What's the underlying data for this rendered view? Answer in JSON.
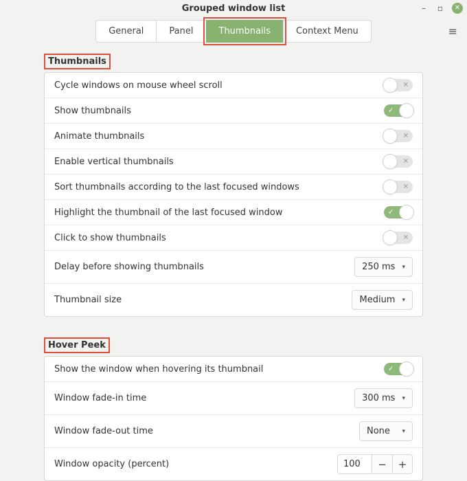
{
  "window": {
    "title": "Grouped window list"
  },
  "tabs": {
    "general": "General",
    "panel": "Panel",
    "thumbnails": "Thumbnails",
    "context_menu": "Context Menu",
    "active": "thumbnails"
  },
  "sections": {
    "thumbnails": {
      "title": "Thumbnails",
      "rows": {
        "cycle": {
          "label": "Cycle windows on mouse wheel scroll",
          "value": false
        },
        "show": {
          "label": "Show thumbnails",
          "value": true
        },
        "animate": {
          "label": "Animate thumbnails",
          "value": false
        },
        "vertical": {
          "label": "Enable vertical thumbnails",
          "value": false
        },
        "sort": {
          "label": "Sort thumbnails according to the last focused windows",
          "value": false
        },
        "highlight": {
          "label": "Highlight the thumbnail of the last focused window",
          "value": true
        },
        "click": {
          "label": "Click to show thumbnails",
          "value": false
        },
        "delay": {
          "label": "Delay before showing thumbnails",
          "value": "250 ms"
        },
        "size": {
          "label": "Thumbnail size",
          "value": "Medium"
        }
      }
    },
    "hover_peek": {
      "title": "Hover Peek",
      "rows": {
        "show": {
          "label": "Show the window when hovering its thumbnail",
          "value": true
        },
        "fade_in": {
          "label": "Window fade-in time",
          "value": "300 ms"
        },
        "fade_out": {
          "label": "Window fade-out time",
          "value": "None"
        },
        "opacity": {
          "label": "Window opacity (percent)",
          "value": "100"
        }
      }
    }
  },
  "glyphs": {
    "check": "✓",
    "x": "✕",
    "caret": "▾",
    "minus": "−",
    "plus": "+",
    "hamburger": "≡"
  }
}
